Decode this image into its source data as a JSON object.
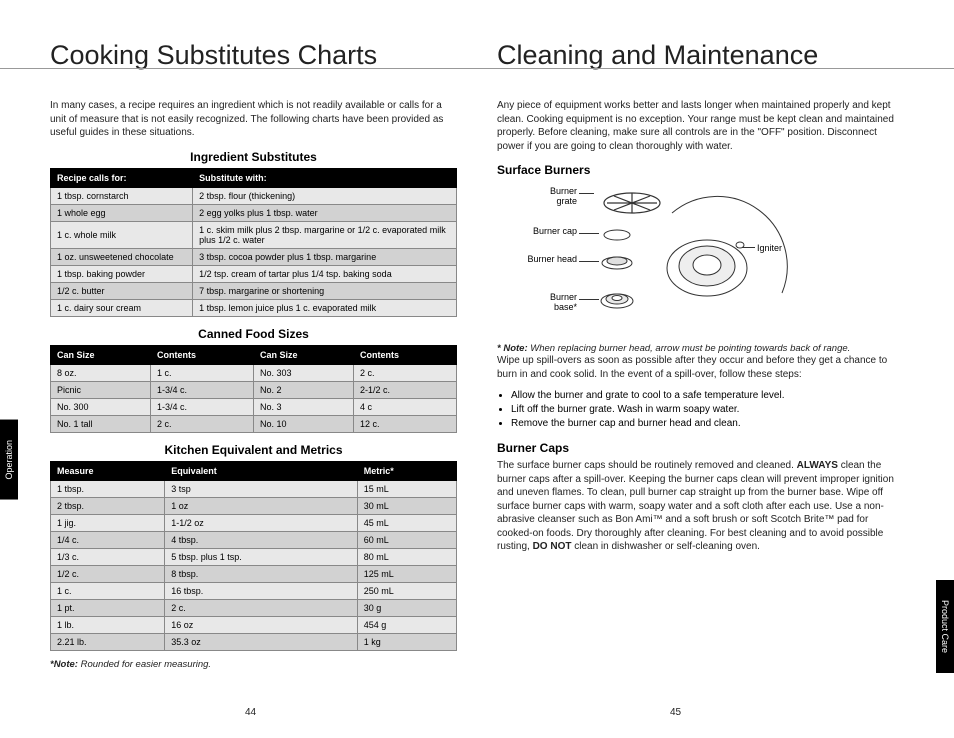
{
  "left": {
    "title": "Cooking Substitutes Charts",
    "intro": "In many cases, a recipe requires an ingredient which is not readily available or calls for a unit of measure that is not easily recognized. The following charts have been provided as useful guides in these situations.",
    "t1_title": "Ingredient Substitutes",
    "t1_h1": "Recipe calls for:",
    "t1_h2": "Substitute with:",
    "t1": [
      [
        "1 tbsp. cornstarch",
        "2 tbsp. flour (thickening)"
      ],
      [
        "1 whole egg",
        "2 egg yolks plus 1 tbsp. water"
      ],
      [
        "1 c. whole milk",
        "1 c. skim milk plus 2 tbsp. margarine or 1/2 c. evaporated milk plus 1/2 c. water"
      ],
      [
        "1 oz. unsweetened chocolate",
        "3 tbsp. cocoa powder plus 1 tbsp. margarine"
      ],
      [
        "1 tbsp. baking powder",
        "1/2 tsp. cream of tartar plus 1/4 tsp. baking soda"
      ],
      [
        "1/2 c. butter",
        "7 tbsp. margarine or shortening"
      ],
      [
        "1 c. dairy sour cream",
        "1 tbsp. lemon juice plus 1 c. evaporated milk"
      ]
    ],
    "t2_title": "Canned Food Sizes",
    "t2_h1": "Can Size",
    "t2_h2": "Contents",
    "t2_h3": "Can Size",
    "t2_h4": "Contents",
    "t2": [
      [
        "8 oz.",
        "1 c.",
        "No. 303",
        "2 c."
      ],
      [
        "Picnic",
        "1-3/4 c.",
        "No. 2",
        "2-1/2 c."
      ],
      [
        "No. 300",
        "1-3/4 c.",
        "No. 3",
        "4 c"
      ],
      [
        "No. 1 tall",
        "2 c.",
        "No. 10",
        "12 c."
      ]
    ],
    "t3_title": "Kitchen Equivalent and Metrics",
    "t3_h1": "Measure",
    "t3_h2": "Equivalent",
    "t3_h3": "Metric*",
    "t3": [
      [
        "1 tbsp.",
        "3 tsp",
        "15 mL"
      ],
      [
        "2 tbsp.",
        "1 oz",
        "30 mL"
      ],
      [
        "1 jig.",
        "1-1/2 oz",
        "45 mL"
      ],
      [
        "1/4 c.",
        "4 tbsp.",
        "60 mL"
      ],
      [
        "1/3 c.",
        "5 tbsp. plus 1 tsp.",
        "80 mL"
      ],
      [
        "1/2 c.",
        "8 tbsp.",
        "125 mL"
      ],
      [
        "1 c.",
        "16 tbsp.",
        "250 mL"
      ],
      [
        "1 pt.",
        "2 c.",
        "30 g"
      ],
      [
        "1 lb.",
        "16 oz",
        "454 g"
      ],
      [
        "2.21 lb.",
        "35.3 oz",
        "1 kg"
      ]
    ],
    "note_b": "*Note:",
    "note": " Rounded for easier measuring.",
    "pagenum": "44"
  },
  "right": {
    "title": "Cleaning and Maintenance",
    "intro": "Any piece of equipment works better and lasts longer when maintained properly and kept clean. Cooking equipment is no exception. Your range must be kept clean and maintained properly. Before cleaning, make sure all controls are in the \"OFF\" position. Disconnect power if you are going to clean thoroughly with water.",
    "h_surface": "Surface Burners",
    "d_grate": "Burner grate",
    "d_cap": "Burner cap",
    "d_head": "Burner head",
    "d_base": "Burner base*",
    "d_igniter": "Igniter",
    "note_b": "* Note:",
    "note": " When replacing burner head, arrow must be pointing towards back of range.",
    "p1": "Wipe up spill-overs as soon as possible after they occur and before they get a chance to burn in and cook solid. In the event of a spill-over, follow these steps:",
    "b1": "Allow the burner and grate to cool to a safe temperature level.",
    "b2": "Lift off the burner grate. Wash in warm soapy water.",
    "b3": "Remove the burner cap and burner head and clean.",
    "h_caps": "Burner Caps",
    "p2a": "The surface burner caps should be routinely removed and cleaned. ",
    "p2_always": "ALWAYS",
    "p2b": " clean the burner caps after a spill-over. Keeping the burner caps clean will prevent improper ignition and uneven flames. To clean, pull burner cap straight up from the burner base. Wipe off surface burner caps with warm, soapy water and a soft cloth after each use. Use a non-abrasive cleanser such as Bon Ami™ and a soft brush or soft Scotch Brite™ pad for cooked-on foods. Dry thoroughly after cleaning. For best cleaning and to avoid possible rusting, ",
    "p2_donot": "DO NOT",
    "p2c": " clean in dishwasher or self-cleaning oven.",
    "pagenum": "45"
  },
  "tab_left": "Operation",
  "tab_right": "Product Care"
}
